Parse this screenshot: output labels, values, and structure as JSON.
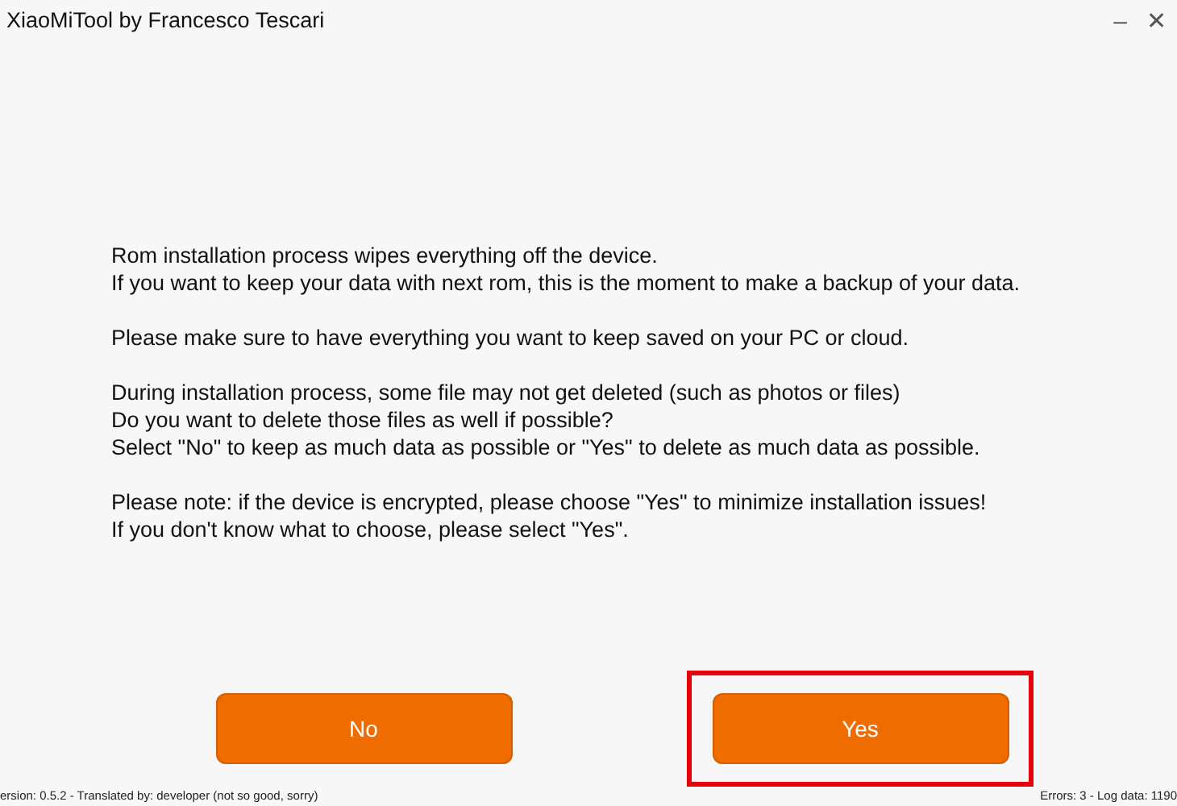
{
  "window": {
    "title": "XiaoMiTool by Francesco Tescari",
    "controls": [
      "–",
      "✕"
    ]
  },
  "paragraphs": [
    [
      "Rom installation process wipes everything off the device.",
      "If you want to keep your data with next rom, this is the moment to make a backup of your data."
    ],
    [
      "Please make sure to have everything you want to keep saved on your PC or cloud."
    ],
    [
      "During installation process, some file may not get deleted (such as photos or files)",
      "Do you want to delete those files as well if possible?",
      "Select \"No\" to keep as much data as possible or \"Yes\" to delete as much data as possible."
    ],
    [
      "Please note: if the device is encrypted, please choose \"Yes\" to minimize installation issues!",
      "If you don't know what to choose, please select \"Yes\"."
    ]
  ],
  "buttons": [
    {
      "label": "No",
      "highlighted": false
    },
    {
      "label": "Yes",
      "highlighted": true
    }
  ],
  "status_bar": {
    "left": "ersion: 0.5.2 - Translated by: developer (not so good, sorry)",
    "right": "Errors: 3 - Log data: 1190"
  }
}
